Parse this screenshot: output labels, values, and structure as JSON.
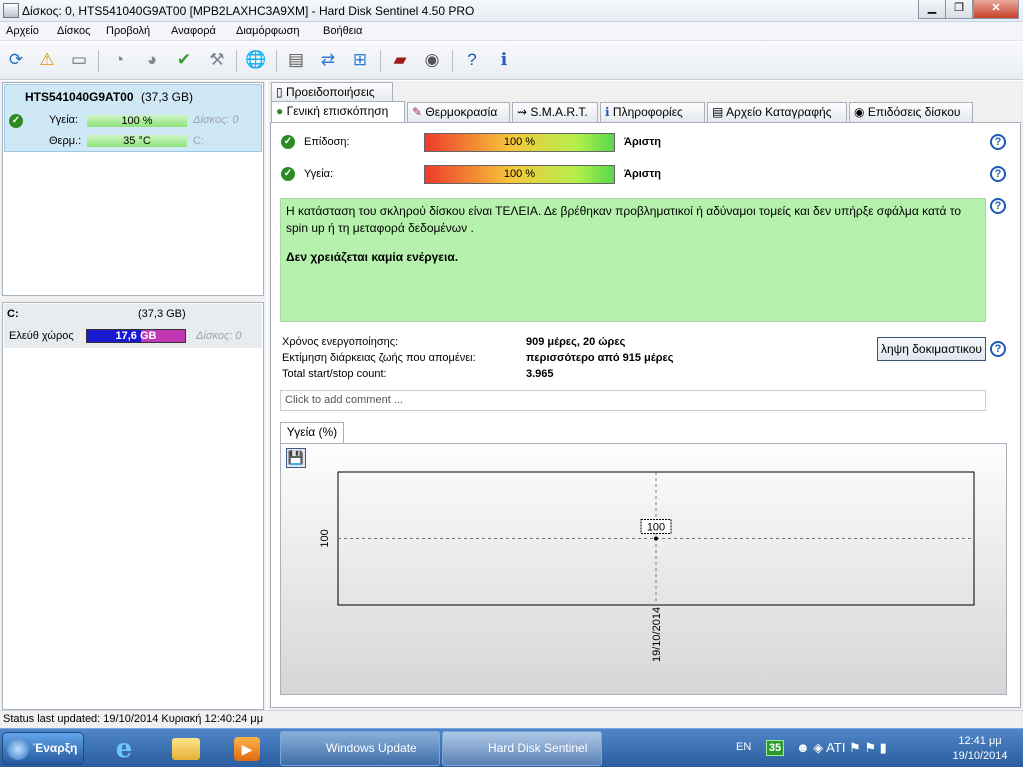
{
  "window": {
    "title": "Δίσκος: 0, HTS541040G9AT00 [MPB2LAXHC3A9XM]  -  Hard Disk Sentinel 4.50 PRO"
  },
  "menu": [
    "Αρχείο",
    "Δίσκος",
    "Προβολή",
    "Αναφορά",
    "Διαμόρφωση",
    "Βοήθεια"
  ],
  "disk": {
    "name": "HTS541040G9AT00",
    "size": "(37,3 GB)",
    "health_label": "Υγεία:",
    "health_value": "100 %",
    "health_pct": 100,
    "temp_label": "Θερμ.:",
    "temp_value": "35 °C",
    "disk_ref": "Δίσκος: 0",
    "vol_ref": "C:"
  },
  "volume": {
    "name": "C:",
    "size": "(37,3 GB)",
    "free_label": "Ελεύθ χώρος",
    "free_value": "17,6 GB",
    "disk_ref": "Δίσκος: 0"
  },
  "tabs_top": [
    "Προειδοποιήσεις"
  ],
  "tabs": [
    "Γενική επισκόπηση",
    "Θερμοκρασία",
    "S.M.A.R.T.",
    "Πληροφορίες",
    "Αρχείο Καταγραφής",
    "Επιδόσεις δίσκου"
  ],
  "overview": {
    "perf_label": "Επίδοση:",
    "perf_value": "100 %",
    "perf_pct": 100,
    "perf_rating": "Άριστη",
    "health_label": "Υγεία:",
    "health_value": "100 %",
    "health_pct": 100,
    "health_rating": "Άριστη",
    "status_text": "Η κατάσταση του σκληρού δίσκου είναι ΤΕΛΕΙΑ. Δε βρέθηκαν προβληματικοί ή αδύναμοι τομείς και δεν υπήρξε σφάλμα κατά το spin up ή τη μεταφορά δεδομένων .",
    "status_action": "Δεν χρειάζεται καμία ενέργεια.",
    "uptime_label": "Χρόνος ενεργοποίησης:",
    "uptime_value": "909 μέρες, 20 ώρες",
    "life_label": "Εκτίμηση διάρκειας ζωής που απομένει:",
    "life_value": "περισσότερο από 915 μέρες",
    "startstop_label": "Total start/stop count:",
    "startstop_value": "3.965",
    "test_button": "ληψη δοκιμαστικου",
    "comment_placeholder": "Click to add comment ..."
  },
  "chart_data": {
    "type": "line",
    "title": "Υγεία (%)",
    "x": [
      "19/10/2014"
    ],
    "values": [
      100
    ],
    "ylabel": "100",
    "ylim": [
      0,
      200
    ],
    "grid": true
  },
  "status": "Status last updated: 19/10/2014 Κυριακή 12:40:24 μμ",
  "taskbar": {
    "start": "Έναρξη",
    "buttons": [
      "Windows Update",
      "Hard Disk Sentinel"
    ],
    "lang": "EN",
    "temp": "35",
    "time": "12:41 μμ",
    "date": "19/10/2014"
  }
}
